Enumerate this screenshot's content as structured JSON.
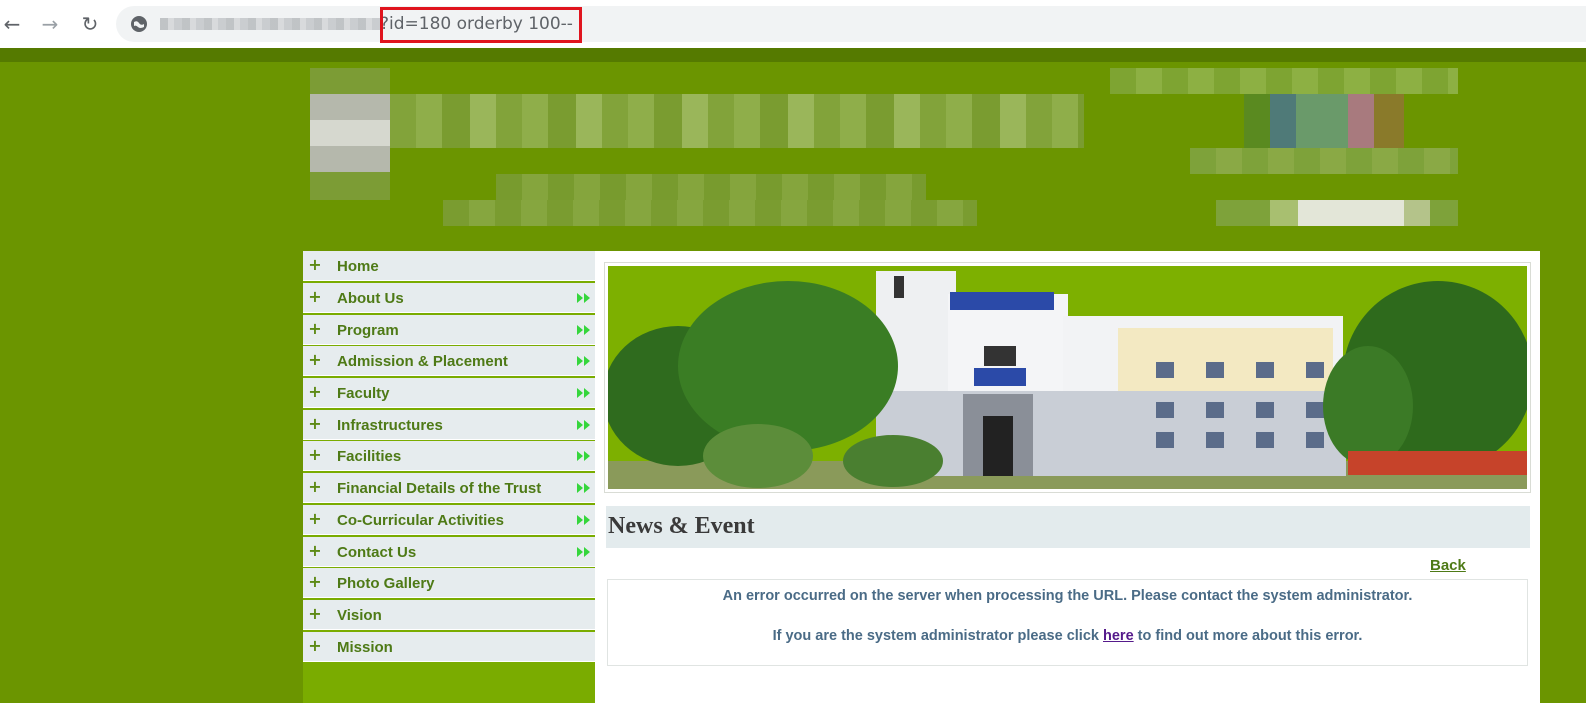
{
  "browser": {
    "url_visible": "?id=180 orderby 100--",
    "icons": {
      "back": "arrow-left-icon",
      "forward": "arrow-right-icon",
      "reload": "reload-icon",
      "site_info": "globe-icon"
    }
  },
  "colors": {
    "page_bg": "#6b9500",
    "sidebar_bg": "#7aac00",
    "menu_item_bg": "#e6ecee",
    "menu_text": "#4e7a16",
    "arrow": "#35d63c",
    "highlight_box": "#e0141e",
    "error_text": "#4a6b86"
  },
  "sidebar": {
    "items": [
      {
        "label": "Home",
        "has_submenu": false
      },
      {
        "label": "About Us",
        "has_submenu": true
      },
      {
        "label": "Program",
        "has_submenu": true
      },
      {
        "label": "Admission & Placement",
        "has_submenu": true
      },
      {
        "label": "Faculty",
        "has_submenu": true
      },
      {
        "label": "Infrastructures",
        "has_submenu": true
      },
      {
        "label": "Facilities",
        "has_submenu": true
      },
      {
        "label": "Financial Details of the Trust",
        "has_submenu": true
      },
      {
        "label": "Co-Curricular Activities",
        "has_submenu": true
      },
      {
        "label": "Contact Us",
        "has_submenu": true
      },
      {
        "label": "Photo Gallery",
        "has_submenu": false
      },
      {
        "label": "Vision",
        "has_submenu": false
      },
      {
        "label": "Mission",
        "has_submenu": false
      }
    ],
    "plus_glyph": "+"
  },
  "main": {
    "section_title": "News & Event",
    "back_label": "Back",
    "error": {
      "line1": "An error occurred on the server when processing the URL. Please contact the system administrator.",
      "line2_before": "If you are the system administrator please click ",
      "line2_link": "here",
      "line2_after": " to find out more about this error."
    }
  }
}
